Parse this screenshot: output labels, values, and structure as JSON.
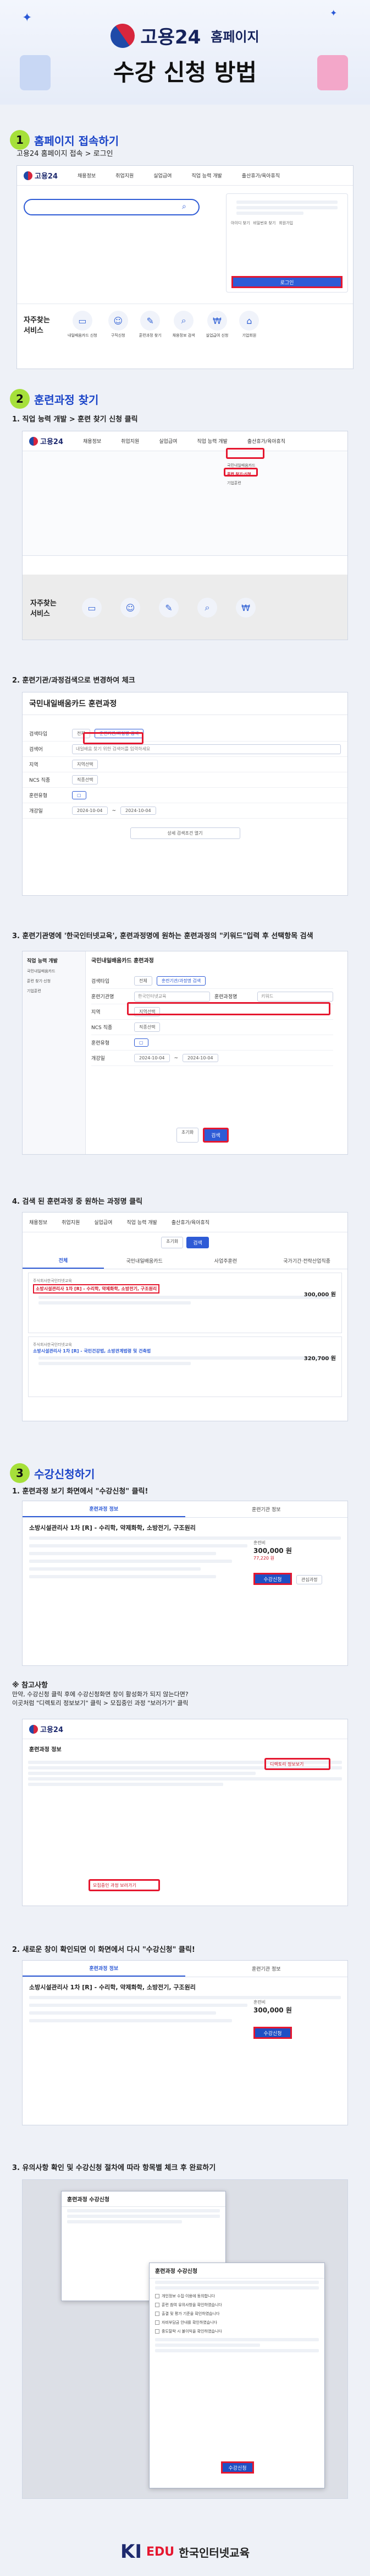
{
  "header": {
    "brand": "고용24",
    "brand_sub": "홈페이지",
    "title": "수강 신청 방법"
  },
  "sections": [
    {
      "num": "1",
      "title": "홈페이지 접속하기",
      "sub": "고용24 홈페이지 접속 > 로그인"
    },
    {
      "num": "2",
      "title": "훈련과정 찾기"
    },
    {
      "num": "3",
      "title": "수강신청하기"
    }
  ],
  "steps": {
    "s2_1": "1. 직업 능력 개발 > 훈련 찾기 신청 클릭",
    "s2_2": "2. 훈련기관/과정검색으로 변경하여 체크",
    "s2_3": "3. 훈련기관명에 '한국인터넷교육', 훈련과정명에 원하는 훈련과정의 \"키워드\"입력 후 선택항목 검색",
    "s2_4": "4. 검색 된 훈련과정 중 원하는 과정명 클릭",
    "s3_1": "1. 훈련과정 보기 화면에서 \"수강신청\" 클릭!",
    "s3_2": "2. 새로운 창이 확인되면 이 화면에서 다시 \"수강신청\" 클릭!",
    "s3_3": "3. 유의사항 확인 및 수강신청 절차에 따라 항목별 체크 후 완료하기"
  },
  "nav": [
    "채용정보",
    "취업지원",
    "실업급여",
    "직업 능력 개발",
    "출산휴가/육아휴직"
  ],
  "nav_dropdown": [
    "직업 능력 개발",
    "국민내일배움카드",
    "훈련 찾기·신청",
    "기업훈련"
  ],
  "quick": {
    "label": "자주찾는 서비스",
    "items": [
      "내일배움카드 신청",
      "구직신청",
      "훈련과정 찾기",
      "채용정보 검색",
      "실업급여 신청",
      "기업회원"
    ]
  },
  "login_panel": {
    "btn": "로그인",
    "items": [
      "아이디 찾기",
      "비밀번호 찾기",
      "회원가입"
    ]
  },
  "search": {
    "title": "국민내일배움카드 훈련과정",
    "labels": [
      "검색타입",
      "검색어",
      "지역",
      "NCS 직종",
      "훈련유형",
      "개강일"
    ],
    "type_options": [
      "전체",
      "훈련기관/과정명 검색"
    ],
    "keyword_ph": "내일배움 찾기 위한 검색어를 입력하세요",
    "region": "지역선택",
    "ncs": "직종선택",
    "date_from": "2024-10-04",
    "date_to": "2024-10-04",
    "search_btn": "검색",
    "reset": "초기화",
    "more": "상세 검색조건 열기"
  },
  "search3": {
    "inst_label": "훈련기관명",
    "inst_val": "한국인터넷교육",
    "course_label": "훈련과정명",
    "course_val": "키워드"
  },
  "results": {
    "tabs": [
      "전체",
      "국민내일배움카드",
      "사업주훈련",
      "국가기간·전략산업직종"
    ],
    "cards": [
      {
        "inst": "주식회사한국인터넷교육",
        "name": "소방시설관리사 1차 [R] - 수리학, 약제화학, 소방전기, 구조원리",
        "price": "300,000 원"
      },
      {
        "inst": "주식회사한국인터넷교육",
        "name": "소방시설관리사 1차 [R] - 국민건강법, 소방관계법령 및 건축법",
        "price": "320,700 원"
      }
    ]
  },
  "course_view": {
    "tabs": [
      "훈련과정 정보",
      "훈련기관 정보"
    ],
    "name": "소방시설관리사 1차 [R] - 수리학, 약제화학, 소방전기, 구조원리",
    "price_label": "훈련비",
    "price": "300,000 원",
    "self_pay": "77,220 원",
    "apply": "수강신청",
    "wish": "관심과정"
  },
  "note": {
    "head": "※ 참고사항",
    "l1": "만약, 수강신청 클릭 후에 수강신청화면 창이 활성화가 되지 않는다면?",
    "l2": "이곳처럼 \"디렉토리 정보보기\" 클릭 > 모집중인 과정 \"보러가기\" 클릭",
    "dir_btn": "디렉토리 정보보기",
    "go_btn": "모집중인 과정 보러가기"
  },
  "modal": {
    "title": "훈련과정 수강신청",
    "items": [
      "개인정보 수집·이용에 동의합니다",
      "훈련 참여 유의사항을 확인하였습니다",
      "출결 및 평가 기준을 확인하였습니다",
      "자비부담금 안내를 확인하였습니다",
      "중도탈락 시 불이익을 확인하였습니다"
    ],
    "submit": "수강신청"
  },
  "footer": {
    "brand": "KI",
    "brand2": "EDU",
    "name": "한국인터넷교육"
  }
}
